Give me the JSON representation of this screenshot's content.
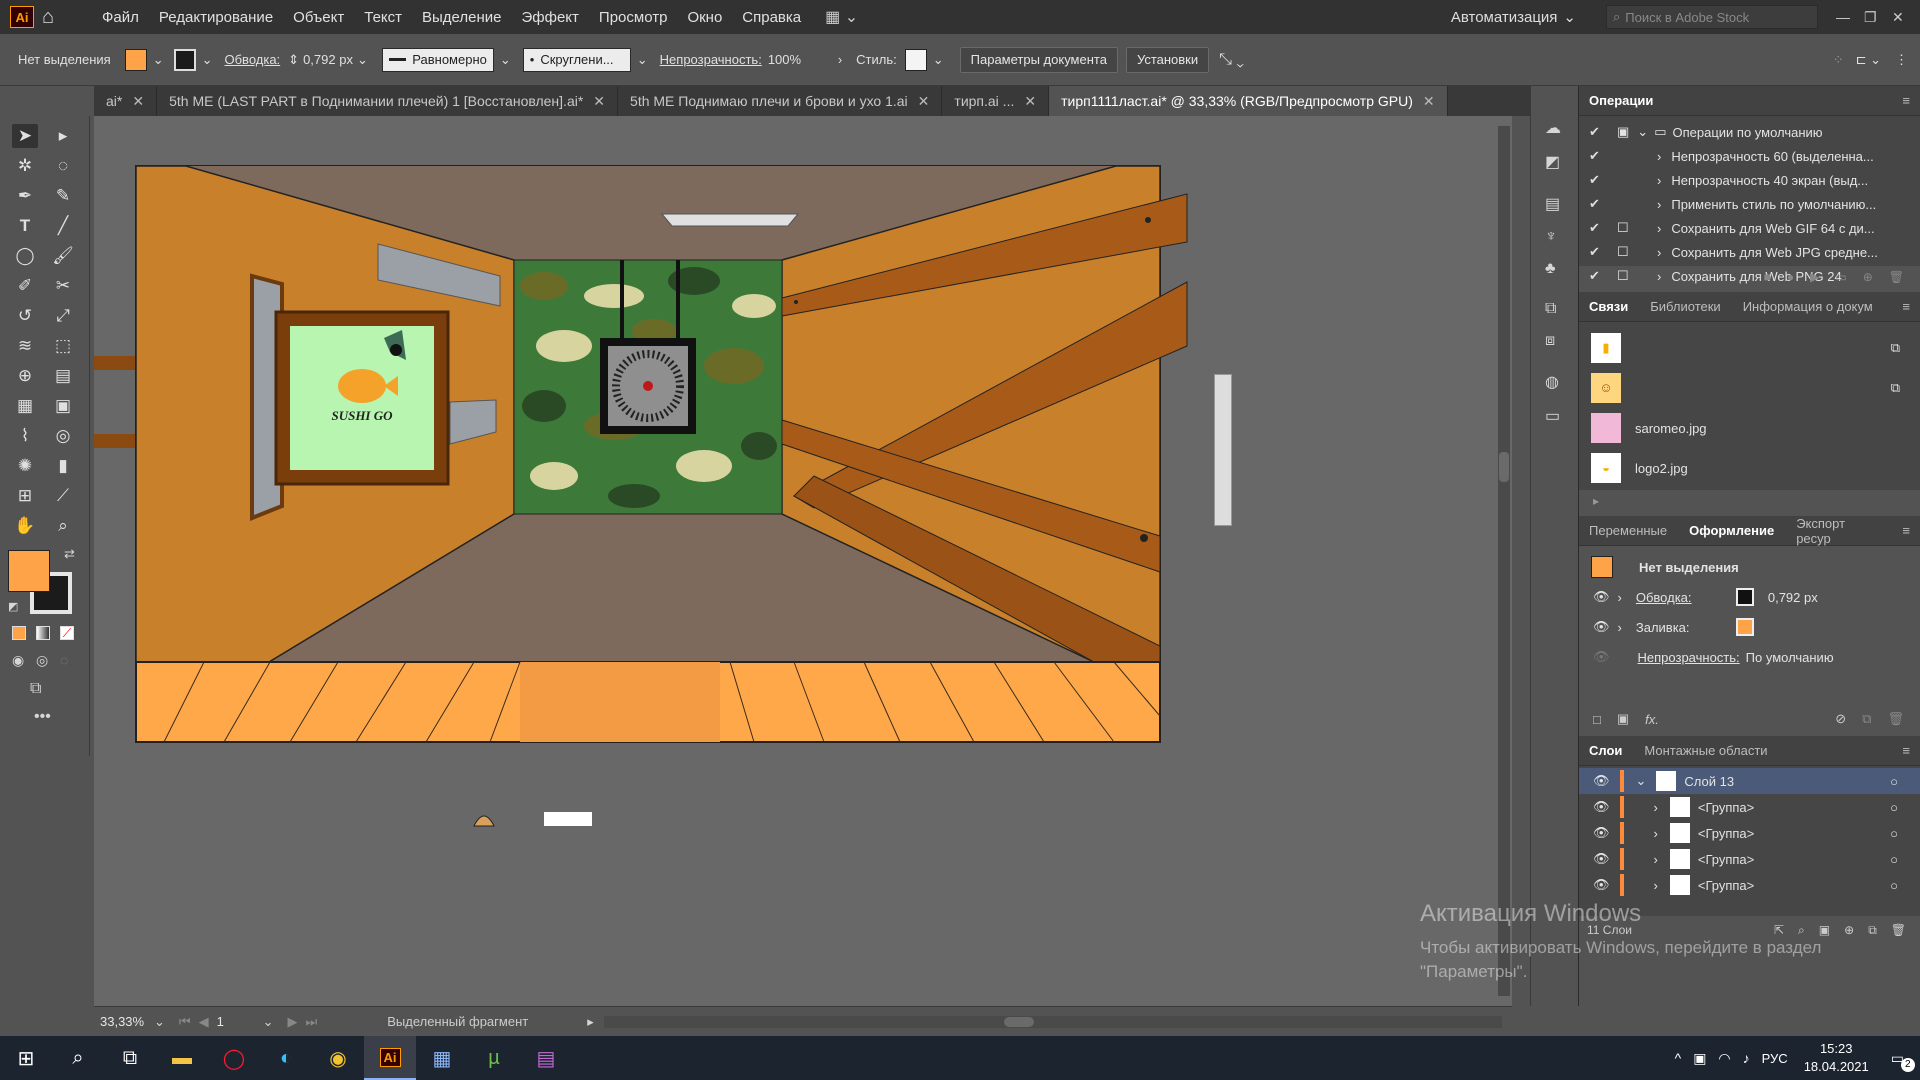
{
  "menubar": {
    "logo": "Ai",
    "items": [
      "Файл",
      "Редактирование",
      "Объект",
      "Текст",
      "Выделение",
      "Эффект",
      "Просмотр",
      "Окно",
      "Справка"
    ],
    "workspace": "Автоматизация",
    "search_placeholder": "Поиск в Adobe Stock"
  },
  "controlbar": {
    "selection": "Нет выделения",
    "stroke_label": "Обводка:",
    "stroke_value": "0,792 px",
    "stroke_profile": "Равномерно",
    "brush": "Скруглени...",
    "opacity_label": "Непрозрачность:",
    "opacity_value": "100%",
    "style_label": "Стиль:",
    "doc_settings": "Параметры документа",
    "preferences": "Установки",
    "fill_color": "#ffa348"
  },
  "tabs": [
    {
      "label": "ai*",
      "active": false
    },
    {
      "label": "5th ME (LAST PART в Поднимании плечей) 1 [Восстановлен].ai*",
      "active": false
    },
    {
      "label": "5th ME Поднимаю плечи и брови и ухо 1.ai",
      "active": false
    },
    {
      "label": "тирп.ai ...",
      "active": false
    },
    {
      "label": "тирп1111ласт.ai* @ 33,33% (RGB/Предпросмотр GPU)",
      "active": true
    }
  ],
  "artwork": {
    "logo_text": "SUSHI GO"
  },
  "panels": {
    "actions": {
      "title": "Операции",
      "set": "Операции по умолчанию",
      "items": [
        "Непрозрачность 60 (выделенна...",
        "Непрозрачность 40 экран (выд...",
        "Применить стиль по умолчанию...",
        "Сохранить для Web GIF 64 с ди...",
        "Сохранить для Web JPG средне...",
        "Сохранить для Web PNG 24"
      ]
    },
    "links": {
      "tabs": [
        "Связи",
        "Библиотеки",
        "Информация о докум"
      ],
      "items": [
        "",
        "",
        "saromeo.jpg",
        "logo2.jpg"
      ]
    },
    "appearance": {
      "tabs": [
        "Переменные",
        "Оформление",
        "Экспорт ресур"
      ],
      "title": "Нет выделения",
      "stroke_label": "Обводка:",
      "stroke_value": "0,792 px",
      "fill_label": "Заливка:",
      "opacity_label": "Непрозрачность:",
      "opacity_value": "По умолчанию"
    },
    "layers": {
      "tabs": [
        "Слои",
        "Монтажные области"
      ],
      "layer": "Слой 13",
      "groups": [
        "<Группа>",
        "<Группа>",
        "<Группа>",
        "<Группа>",
        "<Группа>"
      ],
      "count": "11 Слои"
    }
  },
  "statusbar": {
    "zoom": "33,33%",
    "page": "1",
    "status": "Выделенный фрагмент"
  },
  "watermark": {
    "title": "Активация Windows",
    "text": "Чтобы активировать Windows, перейдите в раздел \"Параметры\"."
  },
  "taskbar": {
    "lang": "РУС",
    "time": "15:23",
    "date": "18.04.2021",
    "notifications": "2"
  }
}
